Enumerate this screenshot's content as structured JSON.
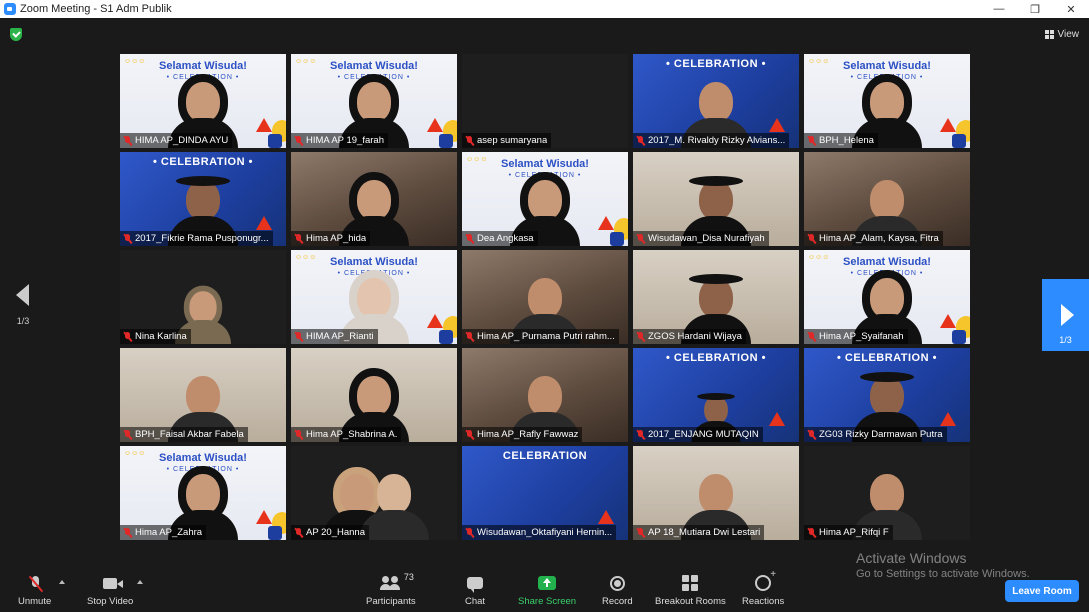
{
  "window": {
    "title": "Zoom Meeting - S1 Adm Publik",
    "minimize": "—",
    "restore": "❐",
    "close": "✕"
  },
  "header": {
    "view_label": "View"
  },
  "pagination": {
    "left_page": "1/3",
    "right_page": "1/3"
  },
  "banner": {
    "greeting": "Selamat Wisuda!",
    "sub": "• CELEBRATION •",
    "celebration": "• CELEBRATION •",
    "celebration_short": "CELEBRATION"
  },
  "participants": [
    {
      "name": "HIMA AP_DINDA AYU",
      "bg": "banner",
      "person": "hijab",
      "active": true
    },
    {
      "name": "HIMA AP 19_farah",
      "bg": "banner",
      "person": "hijab"
    },
    {
      "name": "asep sumaryana",
      "bg": "dark",
      "person": "none"
    },
    {
      "name": "2017_M. Rivaldy Rizky Alvians...",
      "bg": "blue",
      "person": "plain"
    },
    {
      "name": "BPH_Helena",
      "bg": "banner",
      "person": "hijab"
    },
    {
      "name": "2017_Fikrie Rama Pusponugr...",
      "bg": "blue",
      "person": "hat"
    },
    {
      "name": "Hima AP_hida",
      "bg": "room",
      "person": "hijab"
    },
    {
      "name": "Dea Angkasa",
      "bg": "banner",
      "person": "hijab"
    },
    {
      "name": "Wisudawan_Disa Nurafiyah",
      "bg": "wall",
      "person": "hat"
    },
    {
      "name": "Hima AP_Alam, Kaysa, Fitra",
      "bg": "room",
      "person": "plain"
    },
    {
      "name": "Nina Karlina",
      "bg": "dark",
      "person": "hijab-small"
    },
    {
      "name": "HIMA AP_Rianti",
      "bg": "banner",
      "person": "hijab-light"
    },
    {
      "name": "Hima AP_ Purnama Putri rahm...",
      "bg": "room",
      "person": "plain"
    },
    {
      "name": "ZGOS Hardani Wijaya",
      "bg": "wall",
      "person": "hat"
    },
    {
      "name": "Hima AP_Syaifanah",
      "bg": "banner",
      "person": "hijab"
    },
    {
      "name": "BPH_Faisal Akbar Fabela",
      "bg": "wall",
      "person": "plain"
    },
    {
      "name": "Hima AP_Shabrina A.",
      "bg": "wall",
      "person": "hijab"
    },
    {
      "name": "Hima AP_Rafly Fawwaz",
      "bg": "room",
      "person": "plain"
    },
    {
      "name": "2017_ENJANG MUTAQIN",
      "bg": "blue",
      "person": "hat-small"
    },
    {
      "name": "ZG03 Rizky Darmawan Putra",
      "bg": "blue",
      "person": "hat"
    },
    {
      "name": "Hima AP_Zahra",
      "bg": "banner",
      "person": "hijab"
    },
    {
      "name": "AP 20_Hanna",
      "bg": "dark",
      "person": "two"
    },
    {
      "name": "Wisudawan_Oktafiyani Hernin...",
      "bg": "blue",
      "person": "none"
    },
    {
      "name": "AP 18_Mutiara Dwi Lestari",
      "bg": "wall",
      "person": "plain"
    },
    {
      "name": "Hima AP_Rifqi F",
      "bg": "dark",
      "person": "plain"
    }
  ],
  "toolbar": {
    "unmute": "Unmute",
    "stop_video": "Stop Video",
    "participants": "Participants",
    "participants_count": "73",
    "chat": "Chat",
    "share_screen": "Share Screen",
    "record": "Record",
    "breakout_rooms": "Breakout Rooms",
    "reactions": "Reactions",
    "leave_room": "Leave Room"
  },
  "watermark": {
    "line1": "Activate Windows",
    "line2": "Go to Settings to activate Windows."
  },
  "colors": {
    "accent": "#2d8cff",
    "share_green": "#23b14d",
    "active_speaker": "#a8e14a",
    "muted_red": "#e02828"
  }
}
